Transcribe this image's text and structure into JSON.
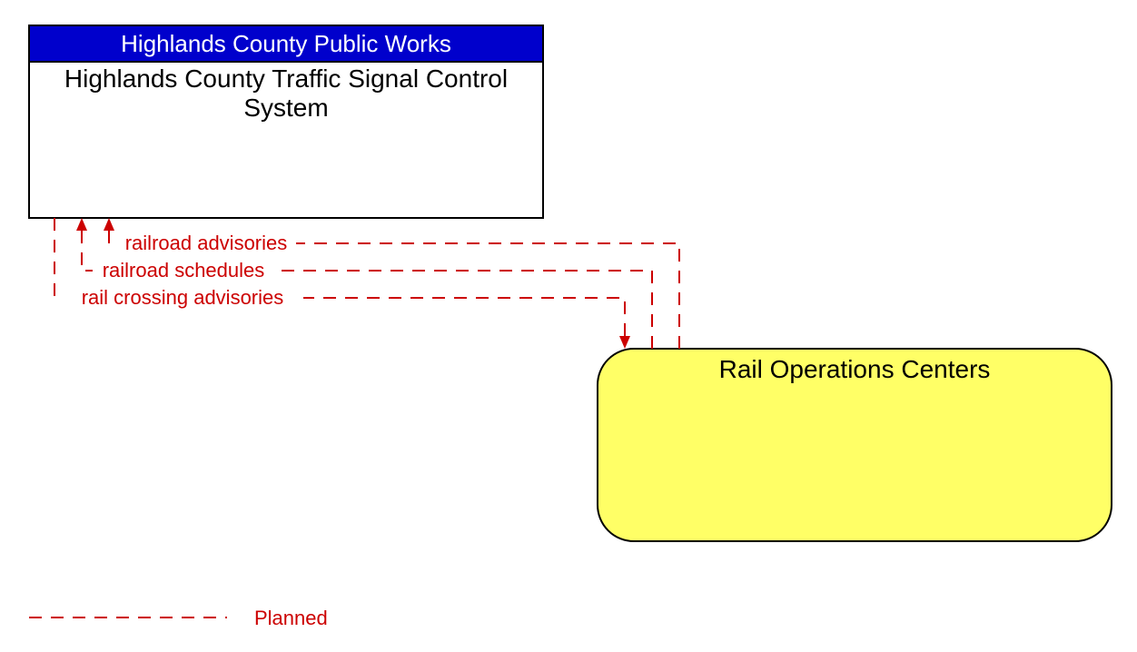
{
  "diagram": {
    "box1": {
      "header": "Highlands County Public Works",
      "title_line1": "Highlands County Traffic Signal Control",
      "title_line2": "System"
    },
    "box2": {
      "title": "Rail Operations Centers"
    },
    "flows": {
      "f1": "railroad advisories",
      "f2": "railroad schedules",
      "f3": "rail crossing advisories"
    },
    "legend": {
      "planned": "Planned"
    }
  }
}
